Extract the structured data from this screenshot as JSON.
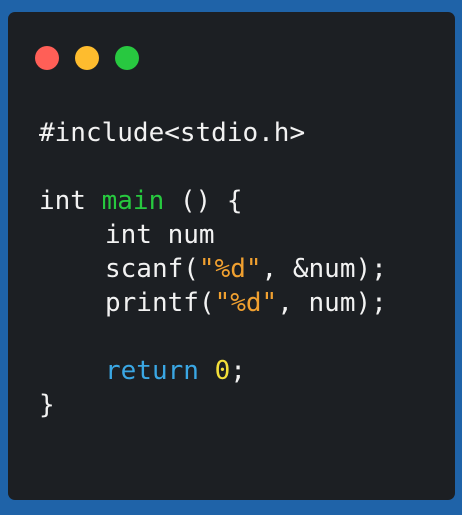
{
  "window": {
    "controls": [
      {
        "name": "close",
        "color": "#ff5f57"
      },
      {
        "name": "minimize",
        "color": "#febc2e"
      },
      {
        "name": "maximize",
        "color": "#28c840"
      }
    ]
  },
  "code": {
    "lines": [
      {
        "parts": [
          "#include<stdio.h>"
        ]
      },
      {
        "parts": []
      },
      {
        "parts": [
          "int ",
          "main",
          " () {"
        ]
      },
      {
        "parts": [
          "int num"
        ]
      },
      {
        "parts": [
          "scanf(",
          "\"%d\"",
          ", &num);"
        ]
      },
      {
        "parts": [
          "printf(",
          "\"%d\"",
          ", num);"
        ]
      },
      {
        "parts": []
      },
      {
        "parts": [
          "return",
          " ",
          "0",
          ";"
        ]
      },
      {
        "parts": [
          "}"
        ]
      }
    ]
  },
  "colors": {
    "background": "#1f63a8",
    "window": "#1c1f23",
    "text": "#f2f2f2",
    "function_green": "#27c93f",
    "string_orange": "#f0a030",
    "keyword_blue": "#3aa7e4",
    "number_yellow": "#f3df3a"
  }
}
